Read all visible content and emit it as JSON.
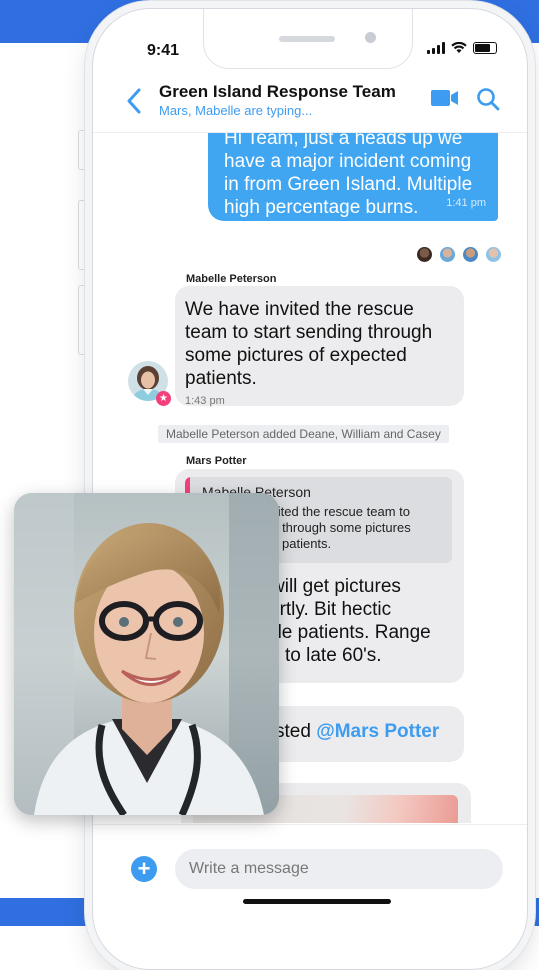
{
  "status_bar": {
    "time": "9:41"
  },
  "header": {
    "title": "Green Island Response Team",
    "subtitle": "Mars, Mabelle are typing..."
  },
  "messages": {
    "outgoing_1": {
      "lines": [
        "Hi Team, just a heads up we",
        "have a major incident coming",
        "in from Green Island. Multiple",
        "high percentage burns."
      ],
      "time": "1:41 pm"
    },
    "incoming_1": {
      "sender": "Mabelle Peterson",
      "lines": [
        "We have invited the rescue",
        "team to start sending through",
        "some pictures of expected",
        "patients."
      ],
      "time": "1:43 pm"
    },
    "system_1": "Mabelle Peterson added Deane, William and Casey",
    "incoming_2": {
      "sender": "Mars Potter",
      "quote_name": "Mabelle Peterson",
      "quote_lines": [
        "nvited the rescue team to",
        "ng through some pictures",
        "patients."
      ],
      "lines": [
        "will get pictures",
        "ortly. Bit hectic",
        "ole patients. Range",
        "to late 60's."
      ]
    },
    "incoming_3": {
      "text_prefix": "sted",
      "mention": "@Mars Potter"
    }
  },
  "composer": {
    "placeholder": "Write a message"
  },
  "colors": {
    "accent": "#3d9cf0",
    "outgoing_bubble": "#41a6f2",
    "incoming_bubble": "#ececee",
    "badge": "#f2417a",
    "brand_band": "#2f6fe0"
  }
}
